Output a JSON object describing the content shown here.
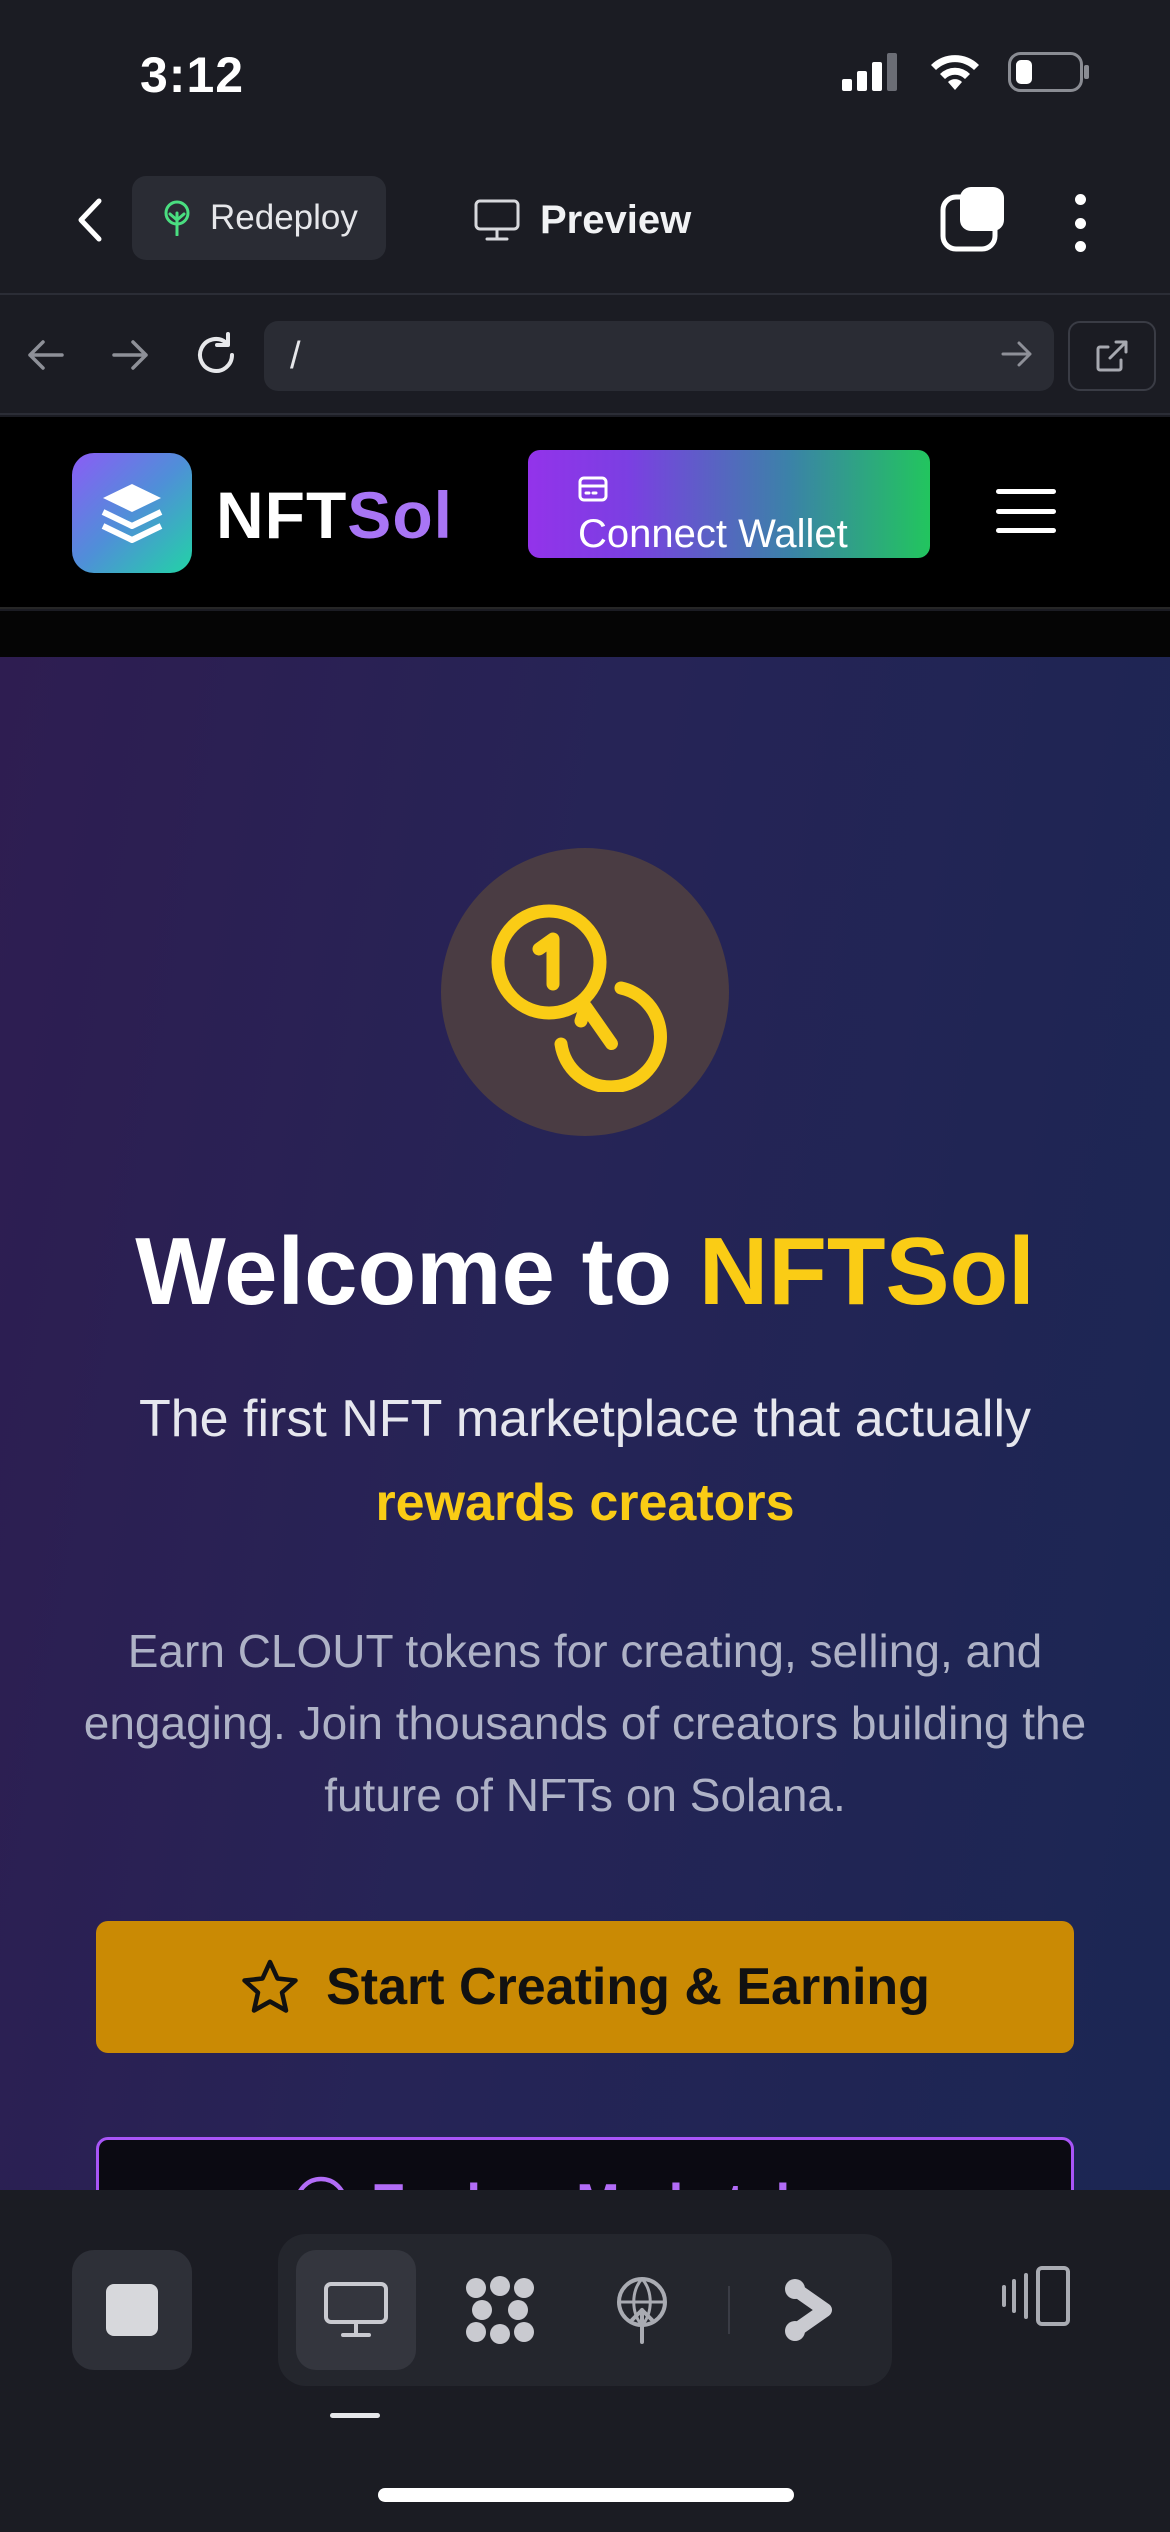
{
  "status_bar": {
    "time": "3:12"
  },
  "app_bar": {
    "redeploy_label": "Redeploy",
    "preview_label": "Preview"
  },
  "url_bar": {
    "url": "/"
  },
  "site_header": {
    "brand_part1": "NFT",
    "brand_part2": "Sol",
    "connect_wallet_label": "Connect Wallet"
  },
  "hero": {
    "title_prefix": "Welcome to ",
    "title_accent": "NFTSol",
    "subtitle": "The first NFT marketplace that actually",
    "subtitle_highlight": "rewards creators",
    "description": "Earn CLOUT tokens for creating, selling, and engaging. Join thousands of creators building the future of NFTs on Solana.",
    "cta_primary_label": "Start Creating & Earning",
    "cta_secondary_label": "Explore Marketplace"
  },
  "colors": {
    "accent_yellow": "#facc15",
    "brand_purple": "#a875f5",
    "cta_gold": "#ca8a04",
    "connect_gradient_start": "#9333ea",
    "connect_gradient_end": "#22c55e"
  },
  "icons": {
    "status": [
      "signal-icon",
      "wifi-icon",
      "battery-icon"
    ],
    "app_bar": [
      "back-chevron-icon",
      "redeploy-tree-icon",
      "monitor-icon",
      "tabs-icon",
      "more-vertical-icon"
    ],
    "url_bar": [
      "back-arrow-icon",
      "forward-arrow-icon",
      "reload-icon",
      "go-arrow-icon",
      "external-link-icon"
    ],
    "hero": [
      "coins-icon",
      "star-icon",
      "compass-icon"
    ],
    "toolbar": [
      "stop-icon",
      "desktop-icon",
      "grid-dots-icon",
      "deploy-globe-icon",
      "branch-icon",
      "side-panel-icon"
    ]
  }
}
